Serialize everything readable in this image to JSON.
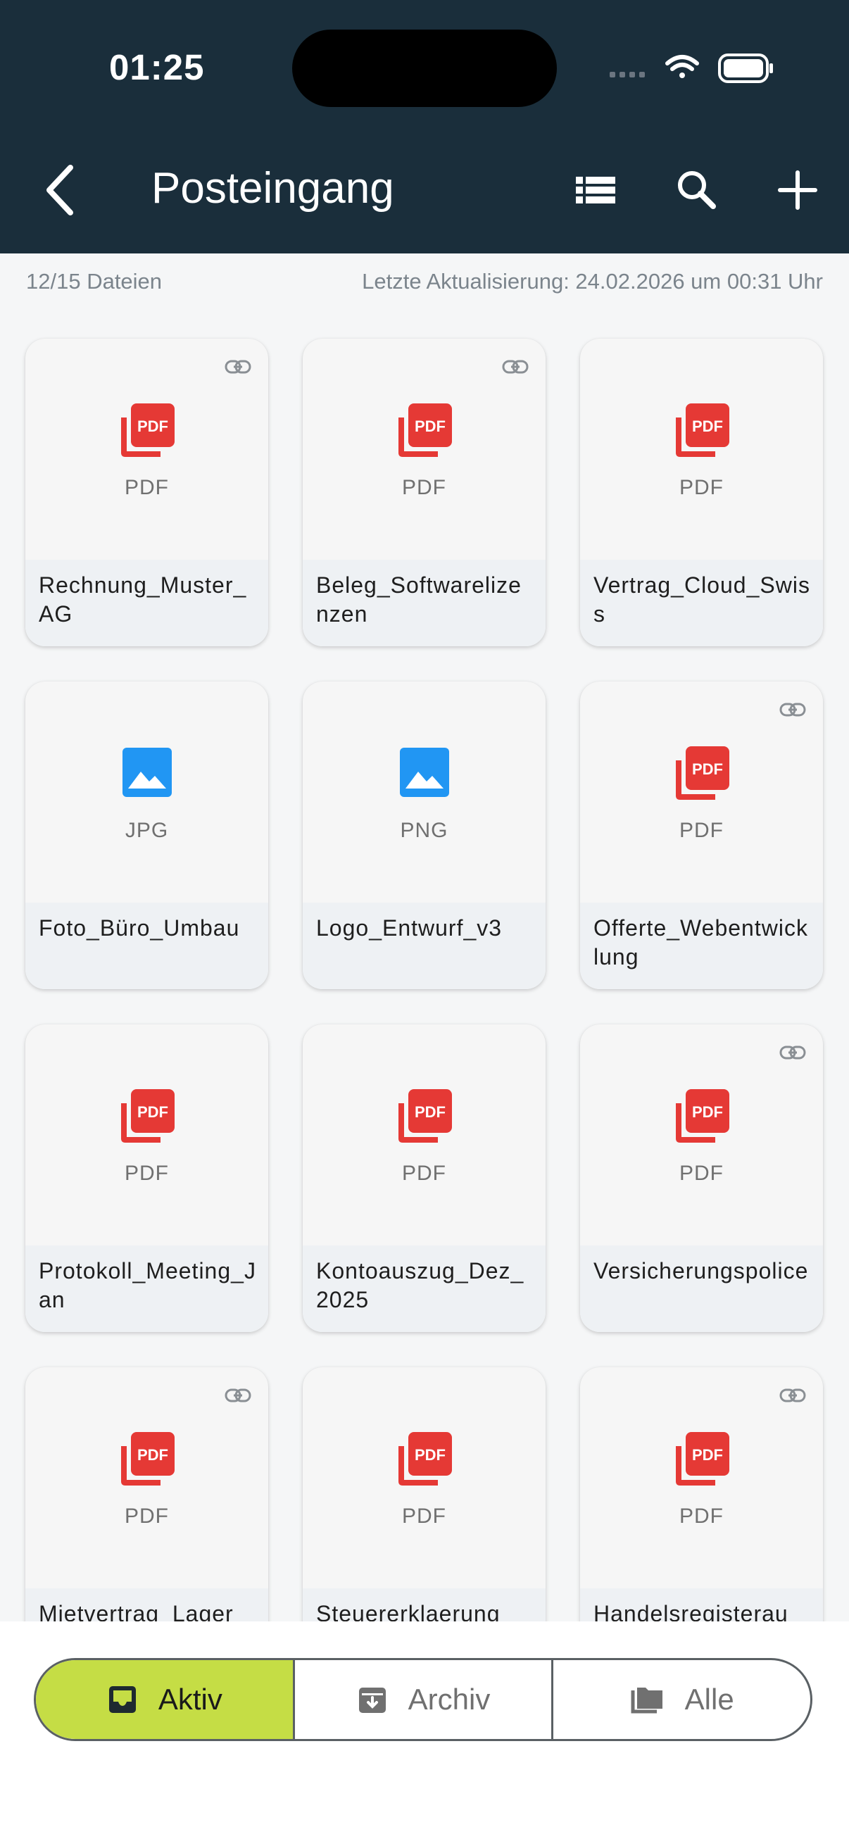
{
  "status_bar": {
    "time": "01:25"
  },
  "nav": {
    "title": "Posteingang",
    "back_icon": "chevron-left-icon",
    "actions": [
      "list-view-icon",
      "search-icon",
      "add-icon"
    ]
  },
  "info": {
    "count": "12/15 Dateien",
    "updated": "Letzte Aktualisierung: 24.02.2026 um 00:31 Uhr"
  },
  "files": [
    {
      "name": "Rechnung_Muster_AG",
      "ext": "PDF",
      "icon": "pdf-icon",
      "linked": true
    },
    {
      "name": "Beleg_Softwarelizenzen",
      "ext": "PDF",
      "icon": "pdf-icon",
      "linked": true
    },
    {
      "name": "Vertrag_Cloud_Swiss",
      "ext": "PDF",
      "icon": "pdf-icon",
      "linked": false
    },
    {
      "name": "Foto_Büro_Umbau",
      "ext": "JPG",
      "icon": "image-icon",
      "linked": false
    },
    {
      "name": "Logo_Entwurf_v3",
      "ext": "PNG",
      "icon": "image-icon",
      "linked": false
    },
    {
      "name": "Offerte_Webentwicklung",
      "ext": "PDF",
      "icon": "pdf-icon",
      "linked": true
    },
    {
      "name": "Protokoll_Meeting_Jan",
      "ext": "PDF",
      "icon": "pdf-icon",
      "linked": false
    },
    {
      "name": "Kontoauszug_Dez_2025",
      "ext": "PDF",
      "icon": "pdf-icon",
      "linked": false
    },
    {
      "name": "Versicherungspolice",
      "ext": "PDF",
      "icon": "pdf-icon",
      "linked": true
    },
    {
      "name": "Mietvertrag_Lager",
      "ext": "PDF",
      "icon": "pdf-icon",
      "linked": true
    },
    {
      "name": "Steuererklaerung",
      "ext": "PDF",
      "icon": "pdf-icon",
      "linked": false
    },
    {
      "name": "Handelsregisterau",
      "ext": "PDF",
      "icon": "pdf-icon",
      "linked": true
    }
  ],
  "tabs": [
    {
      "label": "Aktiv",
      "icon": "inbox-icon",
      "active": true
    },
    {
      "label": "Archiv",
      "icon": "archive-icon",
      "active": false
    },
    {
      "label": "Alle",
      "icon": "folders-icon",
      "active": false
    }
  ],
  "colors": {
    "header_bg": "#1a2e3b",
    "active_tab": "#c5dd45",
    "pdf_red": "#e53935",
    "image_blue": "#2196f3"
  }
}
